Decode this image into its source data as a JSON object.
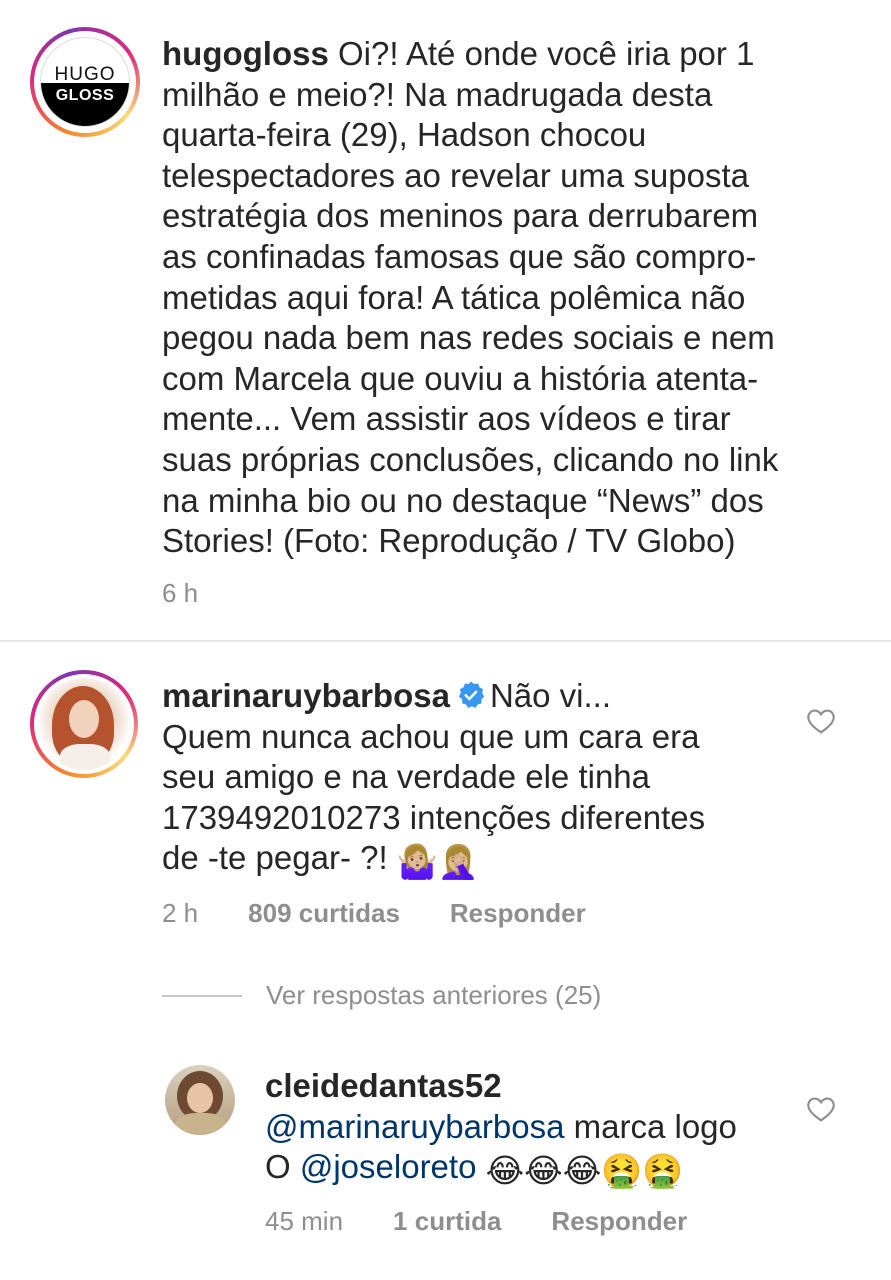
{
  "caption": {
    "username": "hugogloss",
    "avatar_text_top": "HUGO",
    "avatar_text_bottom": "GLOSS",
    "lines": [
      "Oi?! Até onde você iria por 1",
      "milhão e meio?! Na madrugada desta",
      "quarta-feira (29), Hadson chocou",
      "telespectadores ao revelar uma suposta",
      "estratégia dos meninos para derrubarem",
      "as confinadas famosas que são compro-",
      "metidas aqui fora! A tática polêmica não",
      "pegou nada bem nas redes sociais e nem",
      "com Marcela que ouviu a história atenta-",
      "mente... Vem assistir aos vídeos e tirar",
      "suas próprias conclusões, clicando no link",
      "na minha bio ou no destaque “News” dos",
      "Stories! (Foto: Reprodução / TV Globo)"
    ],
    "time": "6 h"
  },
  "comment": {
    "username": "marinaruybarbosa",
    "first_line_text": "Não vi...",
    "lines": [
      "Quem nunca achou que um cara era",
      "seu amigo e na verdade ele tinha",
      "1739492010273 intenções diferentes",
      "de -te pegar- ?!"
    ],
    "emoji": "🤷🏼‍♀️🤦🏼‍♀️",
    "time": "2 h",
    "likes": "809 curtidas",
    "reply_label": "Responder"
  },
  "view_replies": "Ver respostas anteriores (25)",
  "reply": {
    "username": "cleidedantas52",
    "mention1": "@marinaruybarbosa",
    "text1": " marca logo",
    "text2_prefix": "O ",
    "mention2": "@joseloreto",
    "emoji": "😂😂😂🤮🤮",
    "time": "45 min",
    "likes": "1 curtida",
    "reply_label": "Responder"
  },
  "colors": {
    "text": "#262626",
    "meta": "#8e8e8e",
    "mention": "#003569",
    "verified": "#3897f0",
    "divider": "#e6e6e6"
  }
}
